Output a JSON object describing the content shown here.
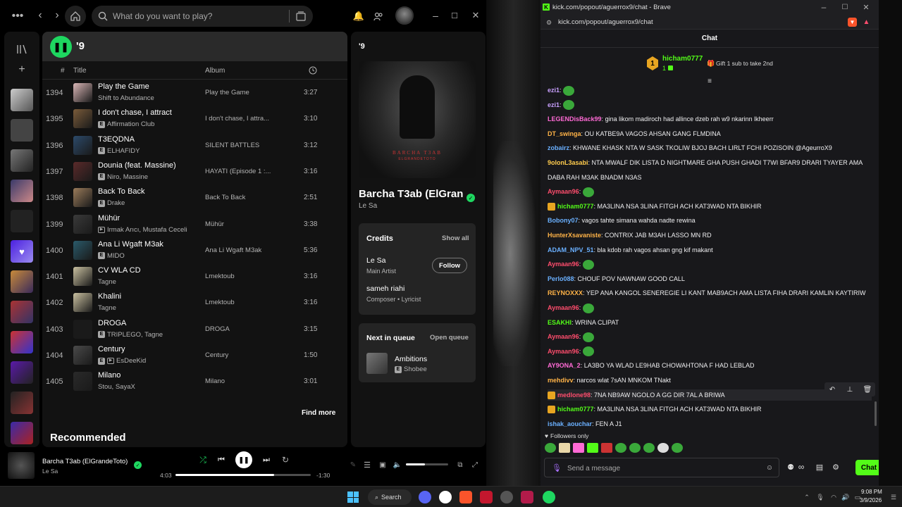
{
  "spotify": {
    "search_placeholder": "What do you want to play?",
    "playlist_title": "'9",
    "header": {
      "num": "#",
      "title": "Title",
      "album": "Album"
    },
    "tracks": [
      {
        "num": "1394",
        "title": "Play the Game",
        "artist": "Shift to Abundance",
        "album": "Play the Game",
        "dur": "3:27",
        "badge": "",
        "color": "#d9b6b6"
      },
      {
        "num": "1395",
        "title": "I don't chase, I attract",
        "artist": "Affirmation Club",
        "album": "I don't chase, I attra...",
        "dur": "3:10",
        "badge": "E",
        "color": "#7a5b3a"
      },
      {
        "num": "1396",
        "title": "T3EQDNA",
        "artist": "ELHAFIDY",
        "album": "SILENT BATTLES",
        "dur": "3:12",
        "badge": "E",
        "color": "#2c4a6a"
      },
      {
        "num": "1397",
        "title": "Dounia (feat. Massine)",
        "artist": "Niro, Massine",
        "album": "HAYATI (Episode 1 :...",
        "dur": "3:16",
        "badge": "E",
        "color": "#5a2a2a"
      },
      {
        "num": "1398",
        "title": "Back To Back",
        "artist": "Drake",
        "album": "Back To Back",
        "dur": "2:51",
        "badge": "E",
        "color": "#9a7b5a"
      },
      {
        "num": "1399",
        "title": "Mühür",
        "artist": "Irmak Arıcı, Mustafa Ceceli",
        "album": "Mühür",
        "dur": "3:38",
        "badge": "V",
        "color": "#3a3a3a"
      },
      {
        "num": "1400",
        "title": "Ana Li Wgaft M3ak",
        "artist": "MIDO",
        "album": "Ana Li Wgaft M3ak",
        "dur": "5:36",
        "badge": "E",
        "color": "#2a5a6a"
      },
      {
        "num": "1401",
        "title": "CV WLA CD",
        "artist": "Tagne",
        "album": "Lmektoub",
        "dur": "3:16",
        "badge": "",
        "color": "#c9c0a0"
      },
      {
        "num": "1402",
        "title": "Khalini",
        "artist": "Tagne",
        "album": "Lmektoub",
        "dur": "3:16",
        "badge": "",
        "color": "#c9c0a0"
      },
      {
        "num": "1403",
        "title": "DROGA",
        "artist": "TRIPLEGO, Tagne",
        "album": "DROGA",
        "dur": "3:15",
        "badge": "E",
        "color": "#1a1a1a"
      },
      {
        "num": "1404",
        "title": "Century",
        "artist": "EsDeeKid",
        "album": "Century",
        "dur": "1:50",
        "badge": "EV",
        "color": "#4a4a4a"
      },
      {
        "num": "1405",
        "title": "Milano",
        "artist": "Stou, SayaX",
        "album": "Milano",
        "dur": "3:01",
        "badge": "",
        "color": "#2a2a2a"
      }
    ],
    "find_more": "Find more",
    "recommended": "Recommended",
    "right_panel": {
      "title": "'9",
      "cover_text": "BARCHA T3AB",
      "cover_sub": "ELGRANDETOTO",
      "song_title": "Barcha T3ab (ElGran",
      "song_artist": "Le Sa",
      "credits_label": "Credits",
      "show_all": "Show all",
      "credit1_name": "Le Sa",
      "credit1_role": "Main Artist",
      "follow": "Follow",
      "credit2_name": "sameh riahi",
      "credit2_role": "Composer • Lyricist",
      "next_label": "Next in queue",
      "open_queue": "Open queue",
      "next_title": "Ambitions",
      "next_artist": "Shobee"
    },
    "player": {
      "title": "Barcha T3ab (ElGrandeToto)",
      "artist": "Le Sa",
      "elapsed": "4:03",
      "remaining": "-1:30",
      "progress": 0.73,
      "volume": 0.45
    }
  },
  "brave": {
    "window_title": "kick.com/popout/aguerrox9/chat - Brave",
    "url": "kick.com/popout/aguerrox9/chat",
    "chat_title": "Chat",
    "pinned_user": "hicham0777",
    "pinned_count": "1",
    "gift_text": "Gift 1 sub to take 2nd",
    "rank": "1",
    "messages": [
      {
        "user": "ezi1",
        "text": "",
        "color": "#c9a0ff",
        "emote": true,
        "crown": false
      },
      {
        "user": "ezi1",
        "text": "",
        "color": "#c9a0ff",
        "emote": true,
        "crown": false
      },
      {
        "user": "LEGENDisBack99",
        "text": "gina likom madiroch had allince dzeb rah w9 nkarinn lkheerr",
        "color": "#ff6ad5",
        "emote": false,
        "crown": false
      },
      {
        "user": "DT_swinga",
        "text": "OU KATBE9A VAGOS AHSAN GANG FLMDINA",
        "color": "#ffb347",
        "emote": false,
        "crown": false
      },
      {
        "user": "zobairz",
        "text": "KHWANE KHASK NTA W SASK TKOLIW BJOJ BACH LIRLT FCHI POZISOIN @AgeurroX9",
        "color": "#6ab0ff",
        "emote": false,
        "crown": false
      },
      {
        "user": "9olonL3asabi",
        "text": "NTA MWALF DIK LISTA D NIGHTMARE GHA PUSH GHADI T7WI BFAR9 DRARI TYAYER AMA",
        "color": "#ffcc4d",
        "emote": false,
        "crown": false
      },
      {
        "user": "",
        "text": "DABA RAH M3AK BNADM N3AS",
        "color": "#ffffff",
        "emote": false,
        "crown": false
      },
      {
        "user": "Aymaan96",
        "text": "",
        "color": "#ff4d6d",
        "emote": true,
        "crown": false
      },
      {
        "user": "hicham0777",
        "text": "MA3LINA NSA 3LINA FITGH ACH KAT3WAD NTA BIKHIR",
        "color": "#53fc18",
        "emote": false,
        "crown": true
      },
      {
        "user": "Bobony07",
        "text": "vagos tahte simana wahda nadte rewina",
        "color": "#6ab0ff",
        "emote": false,
        "crown": false
      },
      {
        "user": "HunterXsavaniste",
        "text": "CONTRIX JAB M3AH LASSO MN RD",
        "color": "#ffb347",
        "emote": false,
        "crown": false
      },
      {
        "user": "ADAM_NPV_51",
        "text": "bla kdob rah vagos ahsan gng kif makant",
        "color": "#6ab0ff",
        "emote": false,
        "crown": false
      },
      {
        "user": "Aymaan96",
        "text": "",
        "color": "#ff4d6d",
        "emote": true,
        "crown": false
      },
      {
        "user": "Perlo088",
        "text": "CHOUF POV NAWNAW GOOD CALL",
        "color": "#6ab0ff",
        "emote": false,
        "crown": false
      },
      {
        "user": "REYNOXXX",
        "text": "YEP ANA KANGOL SENEREGIE LI KANT MAB9ACH AMA LISTA FIHA DRARI KAMLIN KAYTIRIW",
        "color": "#ffb347",
        "emote": false,
        "crown": false
      },
      {
        "user": "Aymaan96",
        "text": "",
        "color": "#ff4d6d",
        "emote": true,
        "crown": false
      },
      {
        "user": "ESAKHI",
        "text": "WRINA CLIPAT",
        "color": "#53fc18",
        "emote": false,
        "crown": false
      },
      {
        "user": "Aymaan96",
        "text": "",
        "color": "#ff4d6d",
        "emote": true,
        "crown": false
      },
      {
        "user": "Aymaan96",
        "text": "",
        "color": "#ff4d6d",
        "emote": true,
        "crown": false
      },
      {
        "user": "AY9ONA_2",
        "text": "LA3BO YA WLAD LE9HAB CHOWAHTONA F HAD LEBLAD",
        "color": "#ff6ad5",
        "emote": false,
        "crown": false
      },
      {
        "user": "mehdivv",
        "text": "narcos wlat 7sAN MNKOM TNakt",
        "color": "#ffb347",
        "emote": false,
        "crown": false
      },
      {
        "user": "medlone98",
        "text": "7NA NB9AW NGOLO A GG DIR 7AL A BRIWA",
        "color": "#ff4d6d",
        "emote": false,
        "crown": true
      },
      {
        "user": "hicham0777",
        "text": "MA3LINA NSA 3LINA FITGH ACH KAT3WAD NTA BIKHIR",
        "color": "#53fc18",
        "emote": false,
        "crown": true
      },
      {
        "user": "ishak_aouchar",
        "text": "FEN A J1",
        "color": "#6ab0ff",
        "emote": false,
        "crown": false
      }
    ],
    "followers_only": "Followers only",
    "send_placeholder": "Send a message",
    "chat_button": "Chat"
  },
  "taskbar": {
    "search": "Search",
    "time": "9:08 PM",
    "date": "3/9/2026"
  }
}
